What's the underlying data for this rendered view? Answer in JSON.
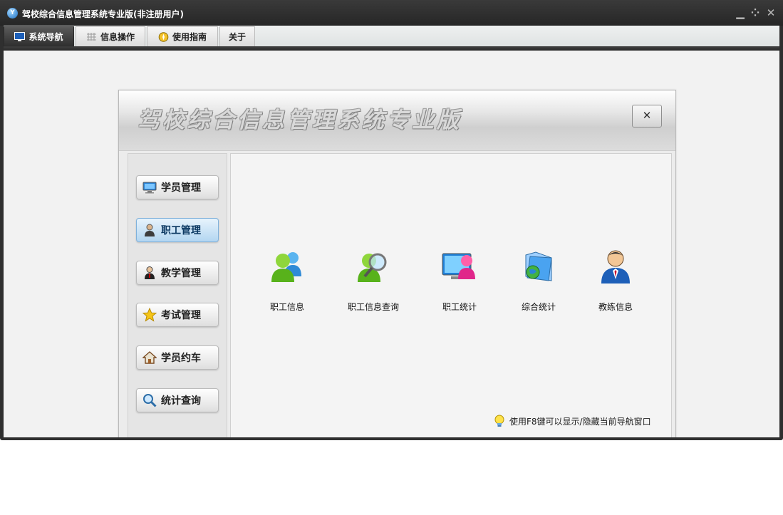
{
  "window": {
    "title": "驾校综合信息管理系统专业版(非注册用户)",
    "logo_text": "Y",
    "controls": [
      "minimize-icon",
      "restore-icon",
      "close-icon"
    ]
  },
  "tabs": [
    {
      "label": "系统导航",
      "icon": "monitor-icon",
      "active": true
    },
    {
      "label": "信息操作",
      "icon": "grid-icon",
      "active": false
    },
    {
      "label": "使用指南",
      "icon": "compass-icon",
      "active": false
    },
    {
      "label": "关于",
      "icon": "",
      "active": false
    }
  ],
  "panel": {
    "title": "驾校综合信息管理系统专业版",
    "close_label": "✕"
  },
  "sidebar": {
    "items": [
      {
        "label": "学员管理",
        "icon": "monitor-icon",
        "active": false
      },
      {
        "label": "职工管理",
        "icon": "person-icon",
        "active": true
      },
      {
        "label": "教学管理",
        "icon": "teacher-icon",
        "active": false
      },
      {
        "label": "考试管理",
        "icon": "star-icon",
        "active": false
      },
      {
        "label": "学员约车",
        "icon": "house-icon",
        "active": false
      },
      {
        "label": "统计查询",
        "icon": "magnifier-icon",
        "active": false
      }
    ]
  },
  "features": [
    {
      "label": "职工信息",
      "icon": "users-icon"
    },
    {
      "label": "职工信息查询",
      "icon": "user-search-icon"
    },
    {
      "label": "职工统计",
      "icon": "user-monitor-icon"
    },
    {
      "label": "综合统计",
      "icon": "folder-globe-icon"
    },
    {
      "label": "教练信息",
      "icon": "coach-icon"
    }
  ],
  "hint": {
    "text": "使用F8键可以显示/隐藏当前导航窗口",
    "icon": "lightbulb-icon"
  },
  "colors": {
    "titlebar": "#2f2f2f",
    "active_tab": "#3a3a3a",
    "active_sidebar": "#b3d6f1"
  }
}
